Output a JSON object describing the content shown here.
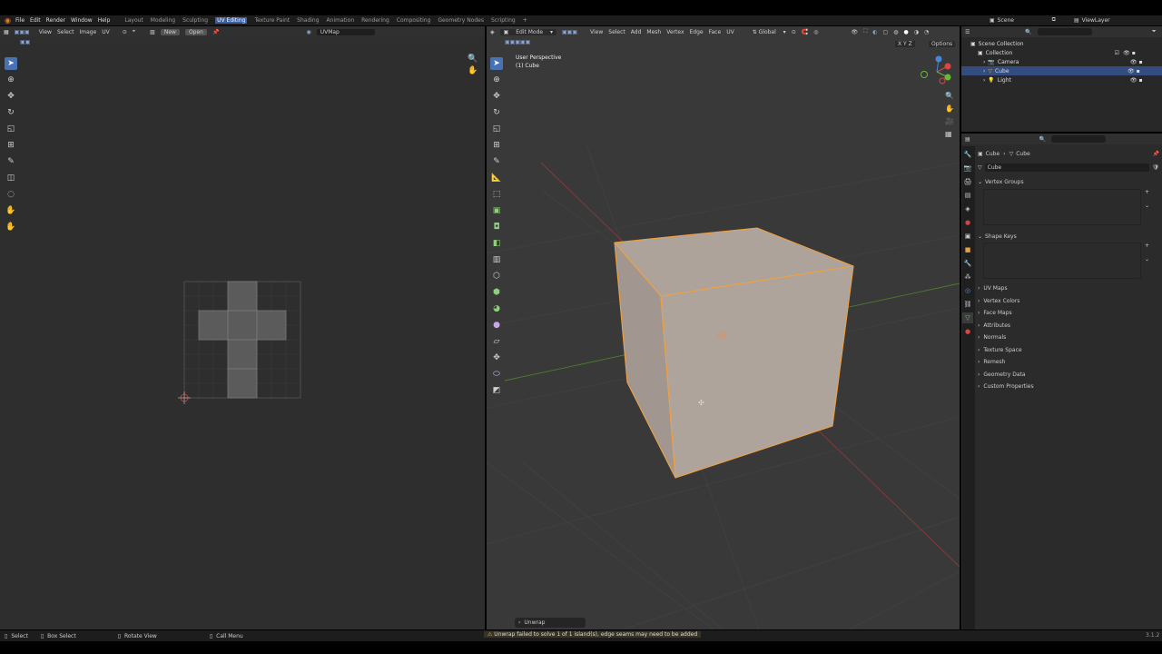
{
  "topbar": {
    "menus": [
      "File",
      "Edit",
      "Render",
      "Window",
      "Help"
    ],
    "workspaces": [
      "Layout",
      "Modeling",
      "Sculpting",
      "UV Editing",
      "Texture Paint",
      "Shading",
      "Animation",
      "Rendering",
      "Compositing",
      "Geometry Nodes",
      "Scripting"
    ],
    "active_workspace": "UV Editing",
    "scene": "Scene",
    "view_layer": "ViewLayer"
  },
  "uv_editor": {
    "menus": [
      "View",
      "Select",
      "Image",
      "UV"
    ],
    "new_label": "New",
    "open_label": "Open",
    "uvmap_field": "UVMap"
  },
  "viewport": {
    "mode": "Edit Mode",
    "menus": [
      "View",
      "Select",
      "Add",
      "Mesh",
      "Vertex",
      "Edge",
      "Face",
      "UV"
    ],
    "orientation": "Global",
    "perspective_label": "User Perspective",
    "object_label": "(1) Cube",
    "options_label": "Options",
    "axes": "X Y Z",
    "last_op": "Unwrap"
  },
  "outliner": {
    "root": "Scene Collection",
    "collection": "Collection",
    "items": [
      "Camera",
      "Cube",
      "Light"
    ],
    "selected": "Cube"
  },
  "properties": {
    "breadcrumb_object": "Cube",
    "breadcrumb_mesh": "Cube",
    "mesh_name": "Cube",
    "panels_open": [
      "Vertex Groups",
      "Shape Keys"
    ],
    "panels_closed": [
      "UV Maps",
      "Vertex Colors",
      "Face Maps",
      "Attributes",
      "Normals",
      "Texture Space",
      "Remesh",
      "Geometry Data",
      "Custom Properties"
    ]
  },
  "statusbar": {
    "select": "Select",
    "box_select": "Box Select",
    "rotate": "Rotate View",
    "call_menu": "Call Menu",
    "warning": "Unwrap failed to solve 1 of 1 island(s), edge seams may need to be added",
    "version": "3.1.2"
  },
  "colors": {
    "accent": "#4772b3",
    "warning": "#e8b33a",
    "mesh_face": "#a89e96",
    "mesh_edge": "#f0a040"
  }
}
